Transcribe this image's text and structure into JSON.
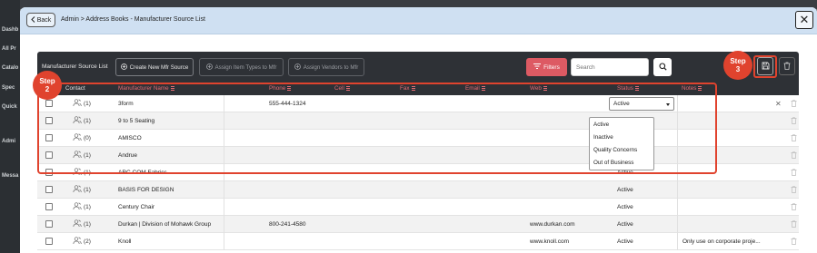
{
  "background": {
    "sidebar_labels": [
      "Dashb",
      "All Pr",
      "Catalo",
      "Spec",
      "Quick",
      "Admi",
      "Messa"
    ]
  },
  "header": {
    "back_label": "Back",
    "breadcrumb": "Admin > Address Books - Manufacturer Source List",
    "close_glyph": "✕"
  },
  "toolbar": {
    "title": "Manufacturer Source List",
    "create_label": "Create New Mfr Source",
    "assign_item_types_label": "Assign Item Types to Mfr",
    "assign_vendors_label": "Assign Vendors to Mfr",
    "filters_label": "Filters",
    "search_placeholder": "Search"
  },
  "annotations": {
    "step2_title": "Step",
    "step2_number": "2",
    "step3_title": "Step",
    "step3_number": "3",
    "accent_color": "#e0432e"
  },
  "table": {
    "columns": [
      "Contact",
      "Manufacturer Name",
      "Phone",
      "Cell",
      "Fax",
      "Email",
      "Web",
      "Status",
      "Notes"
    ],
    "rows": [
      {
        "count": "(1)",
        "name": "3form",
        "phone": "555-444-1324",
        "web": "",
        "status": "Active",
        "notes": ""
      },
      {
        "count": "(1)",
        "name": "9 to 5 Seating",
        "phone": "",
        "web": "",
        "status": "",
        "notes": ""
      },
      {
        "count": "(0)",
        "name": "AMISCO",
        "phone": "",
        "web": "",
        "status": "",
        "notes": ""
      },
      {
        "count": "(1)",
        "name": "Andrue",
        "phone": "",
        "web": "",
        "status": "",
        "notes": ""
      },
      {
        "count": "(1)",
        "name": "ARC COM Fabrics",
        "phone": "",
        "web": "",
        "status": "Active",
        "notes": ""
      },
      {
        "count": "(1)",
        "name": "BASIS FOR DESIGN",
        "phone": "",
        "web": "",
        "status": "Active",
        "notes": ""
      },
      {
        "count": "(1)",
        "name": "Century Chair",
        "phone": "",
        "web": "",
        "status": "Active",
        "notes": ""
      },
      {
        "count": "(1)",
        "name": "Durkan | Division of Mohawk Group",
        "phone": "800-241-4580",
        "web": "www.durkan.com",
        "status": "Active",
        "notes": ""
      },
      {
        "count": "(2)",
        "name": "Knoll",
        "phone": "",
        "web": "www.knoll.com",
        "status": "Active",
        "notes": "Only use on corporate proje..."
      }
    ],
    "status_dropdown": {
      "selected": "Active",
      "options": [
        "Active",
        "Inactive",
        "Quality Concerns",
        "Out of Business"
      ]
    }
  }
}
